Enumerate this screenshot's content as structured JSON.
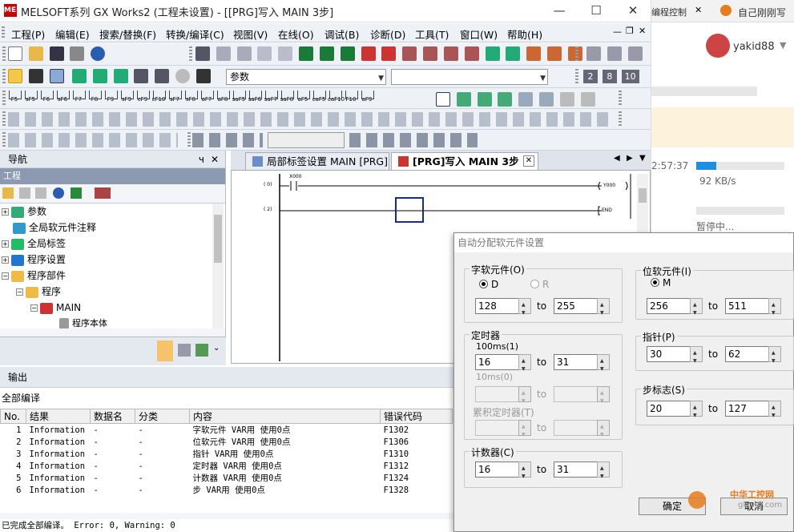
{
  "window": {
    "title": "MELSOFT系列 GX Works2 (工程未设置) - [[PRG]写入 MAIN 3步]",
    "app_icon_text": "MEL"
  },
  "menu": [
    "工程(P)",
    "编辑(E)",
    "搜索/替换(F)",
    "转换/编译(C)",
    "视图(V)",
    "在线(O)",
    "调试(B)",
    "诊断(D)",
    "工具(T)",
    "窗口(W)",
    "帮助(H)"
  ],
  "toolbar": {
    "param_combo": "参数",
    "fkeys": [
      "F5",
      "sF5",
      "F6",
      "sF6",
      "F7",
      "F8",
      "F9",
      "sF9",
      "cF9",
      "cF10",
      "sF7",
      "sF8",
      "aF7",
      "aF8",
      "saF5",
      "saF6",
      "saF7",
      "saF8",
      "aF5",
      "caF5",
      "caF10",
      "F10",
      "aF9"
    ],
    "zoom_buttons": [
      "2",
      "8",
      "10"
    ]
  },
  "nav": {
    "title": "导航",
    "pin": "ч",
    "close": "✕",
    "section": "工程",
    "items": [
      "参数",
      "全局软元件注释",
      "全局标签",
      "程序设置",
      "程序部件",
      "程序",
      "MAIN",
      "程序本体"
    ]
  },
  "editor": {
    "tabs": [
      "局部标签设置 MAIN [PRG]",
      "[PRG]写入 MAIN 3步"
    ],
    "rungs": [
      {
        "step": "0",
        "contact": "X000",
        "coil": "Y000"
      },
      {
        "step": "2",
        "end": "END"
      }
    ]
  },
  "output": {
    "title": "输出",
    "subtitle": "全部编译",
    "columns": [
      "No.",
      "结果",
      "数据名",
      "分类",
      "内容",
      "错误代码"
    ],
    "rows": [
      [
        "1",
        "Information",
        "-",
        "-",
        "字软元件 VAR用 使用0点",
        "F1302"
      ],
      [
        "2",
        "Information",
        "-",
        "-",
        "位软元件 VAR用 使用0点",
        "F1306"
      ],
      [
        "3",
        "Information",
        "-",
        "-",
        "指针 VAR用 使用0点",
        "F1310"
      ],
      [
        "4",
        "Information",
        "-",
        "-",
        "定时器 VAR用 使用0点",
        "F1312"
      ],
      [
        "5",
        "Information",
        "-",
        "-",
        "计数器 VAR用 使用0点",
        "F1324"
      ],
      [
        "6",
        "Information",
        "-",
        "-",
        "步 VAR用 使用0点",
        "F1328"
      ]
    ],
    "status": "已完成全部编译。 Error: 0, Warning: 0"
  },
  "dialog": {
    "title": "自动分配软元件设置",
    "word": {
      "title": "字软元件(O)",
      "radio_d": "D",
      "radio_r": "R",
      "from": "128",
      "to": "255"
    },
    "bit": {
      "title": "位软元件(I)",
      "radio_m": "M",
      "from": "256",
      "to": "511"
    },
    "timer": {
      "title": "定时器",
      "t100": "100ms(1)",
      "t100_from": "16",
      "t100_to": "31",
      "t10": "10ms(0)",
      "acc": "累积定时器(T)"
    },
    "pointer": {
      "title": "指针(P)",
      "from": "30",
      "to": "62"
    },
    "step": {
      "title": "步标志(S)",
      "from": "20",
      "to": "127"
    },
    "counter": {
      "title": "计数器(C)",
      "from": "16",
      "to": "31"
    },
    "to_label": "to",
    "ok": "确定",
    "cancel": "取消"
  },
  "right": {
    "tab1": "编程控制",
    "tab2": "自己刚刚写",
    "user": "yakid88",
    "time": "2:57:37",
    "speed": "92 KB/s",
    "paused": "暂停中...",
    "watermark": "中华工控网",
    "watermark_url": "gkong.com"
  }
}
